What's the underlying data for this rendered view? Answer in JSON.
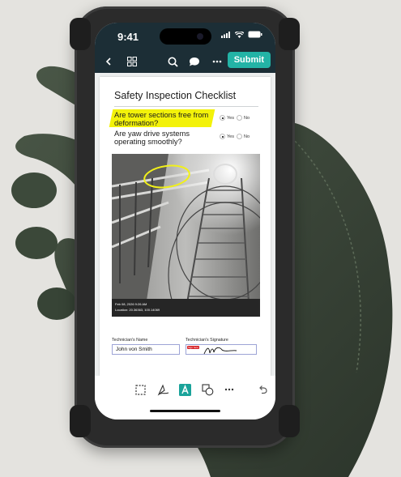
{
  "status_bar": {
    "time": "9:41"
  },
  "toolbar": {
    "back_icon": "chevron-left-icon",
    "grid_icon": "grid-icon",
    "search_icon": "search-icon",
    "comment_icon": "comment-icon",
    "more_icon": "more-icon",
    "submit_label": "Submit"
  },
  "document": {
    "title": "Safety Inspection Checklist",
    "questions": [
      {
        "text": "Are tower sections free from deformation?",
        "yes": "Yes",
        "no": "No",
        "selected": "Yes",
        "highlighted": true
      },
      {
        "text": "Are yaw drive systems operating smoothly?",
        "yes": "Yes",
        "no": "No",
        "selected": "Yes",
        "highlighted": false
      }
    ],
    "photo": {
      "date_line": "Feb 08, 2026 9:26 AM",
      "location_line": "Location: 20.36363, 100.14069"
    },
    "technician_name_label": "Technician's Name",
    "technician_name_value": "John von Smith",
    "technician_signature_label": "Technician's Signature",
    "signature_badge": "Sign here"
  },
  "bottom_toolbar": {
    "icons": [
      "selection-icon",
      "draw-icon",
      "text-annotation-icon",
      "shapes-icon",
      "more-icon",
      "undo-icon"
    ]
  },
  "colors": {
    "toolbar_bg": "#1c2e36",
    "submit_bg": "#23b3a6",
    "highlight": "#f3f20a",
    "field_border": "#9da4d6",
    "text_annotation_active": "#1aa39a"
  }
}
